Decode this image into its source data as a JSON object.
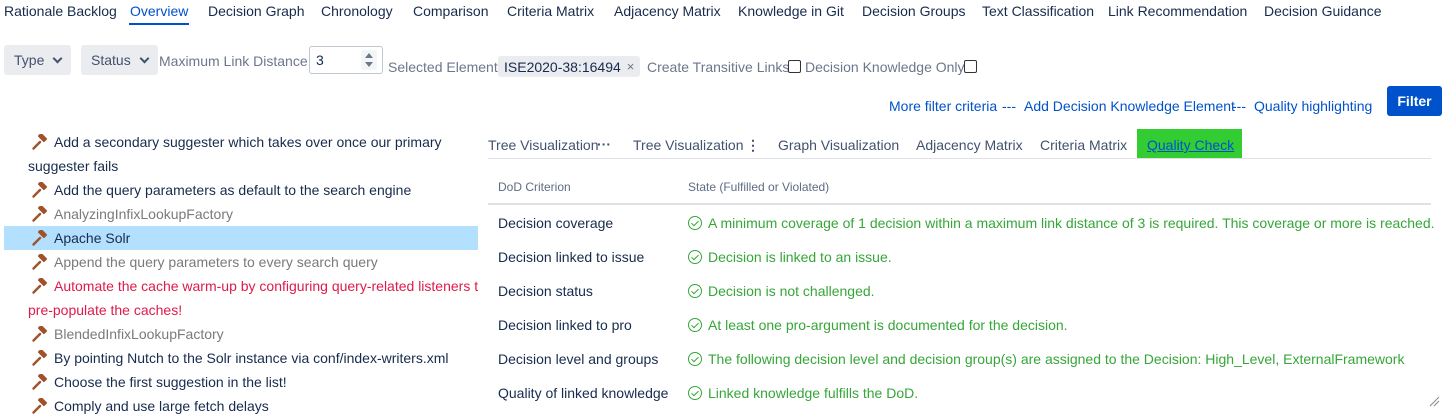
{
  "top_tabs": [
    {
      "label": "Rationale Backlog",
      "active": false
    },
    {
      "label": "Overview",
      "active": true
    },
    {
      "label": "Decision Graph",
      "active": false
    },
    {
      "label": "Chronology",
      "active": false
    },
    {
      "label": "Comparison",
      "active": false
    },
    {
      "label": "Criteria Matrix",
      "active": false
    },
    {
      "label": "Adjacency Matrix",
      "active": false
    },
    {
      "label": "Knowledge in Git",
      "active": false
    },
    {
      "label": "Decision Groups",
      "active": false
    },
    {
      "label": "Text Classification",
      "active": false
    },
    {
      "label": "Link Recommendation",
      "active": false
    },
    {
      "label": "Decision Guidance",
      "active": false
    }
  ],
  "filters": {
    "type_label": "Type",
    "status_label": "Status",
    "max_link_distance_label": "Maximum Link Distance",
    "max_link_distance_value": "3",
    "selected_element_label": "Selected Element:",
    "selected_element_value": "ISE2020-38:16494",
    "chip_remove": "×",
    "transitive_links_label": "Create Transitive Links",
    "transitive_links_checked": false,
    "decision_knowledge_only_label": "Decision Knowledge Only",
    "decision_knowledge_only_checked": false
  },
  "links": {
    "more_filter": "More filter criteria",
    "separator": "---",
    "add_element": "Add Decision Knowledge Element",
    "quality_highlighting": "Quality highlighting"
  },
  "filter_button": "Filter",
  "tree_items": [
    {
      "line1": "Add a secondary suggester which takes over once our primary",
      "line2": "suggester fails",
      "color": "#172b4d",
      "selected": false
    },
    {
      "line1": "Add the query parameters as default to the search engine",
      "color": "#172b4d",
      "selected": false
    },
    {
      "line1": "AnalyzingInfixLookupFactory",
      "color": "#7a7a7a",
      "selected": false
    },
    {
      "line1": "Apache Solr",
      "color": "#172b4d",
      "selected": true
    },
    {
      "line1": "Append the query parameters to every search query",
      "color": "#7a7a7a",
      "selected": false
    },
    {
      "line1": "Automate the cache warm-up by configuring query-related listeners to",
      "line2": "pre-populate the caches!",
      "color": "#de1a4b",
      "selected": false
    },
    {
      "line1": "BlendedInfixLookupFactory",
      "color": "#7a7a7a",
      "selected": false
    },
    {
      "line1": "By pointing Nutch to the Solr instance via conf/index-writers.xml",
      "color": "#172b4d",
      "selected": false
    },
    {
      "line1": "Choose the first suggestion in the list!",
      "color": "#172b4d",
      "selected": false
    },
    {
      "line1": "Comply and use large fetch delays",
      "color": "#172b4d",
      "selected": false
    }
  ],
  "right_tabs": [
    {
      "label": "Tree Visualization",
      "suffix": "···"
    },
    {
      "label": "Tree Visualization",
      "suffix": "⋮"
    },
    {
      "label": "Graph Visualization"
    },
    {
      "label": "Adjacency Matrix"
    },
    {
      "label": "Criteria Matrix"
    },
    {
      "label": "Quality Check",
      "active": true
    }
  ],
  "dod_table": {
    "headers": [
      "DoD Criterion",
      "State (Fulfilled or Violated)"
    ],
    "rows": [
      {
        "criterion": "Decision coverage",
        "state": "A minimum coverage of 1 decision within a maximum link distance of 3 is required. This coverage or more is reached."
      },
      {
        "criterion": "Decision linked to issue",
        "state": "Decision is linked to an issue."
      },
      {
        "criterion": "Decision status",
        "state": "Decision is not challenged."
      },
      {
        "criterion": "Decision linked to pro",
        "state": "At least one pro-argument is documented for the decision."
      },
      {
        "criterion": "Decision level and groups",
        "state": "The following decision level and decision group(s) are assigned to the Decision: High_Level, ExternalFramework"
      },
      {
        "criterion": "Quality of linked knowledge",
        "state": "Linked knowledge fulfills the DoD."
      }
    ]
  },
  "colors": {
    "accent": "#0052cc",
    "selected_row": "#b3e0ff",
    "active_tab_bg": "#33cc33",
    "fulfilled": "#36a639",
    "issue_red": "#de1a4b"
  },
  "icons": {
    "tree_item_icon": "gavel-icon",
    "state_icon": "check-circle-icon",
    "remove_icon": "close-icon"
  }
}
